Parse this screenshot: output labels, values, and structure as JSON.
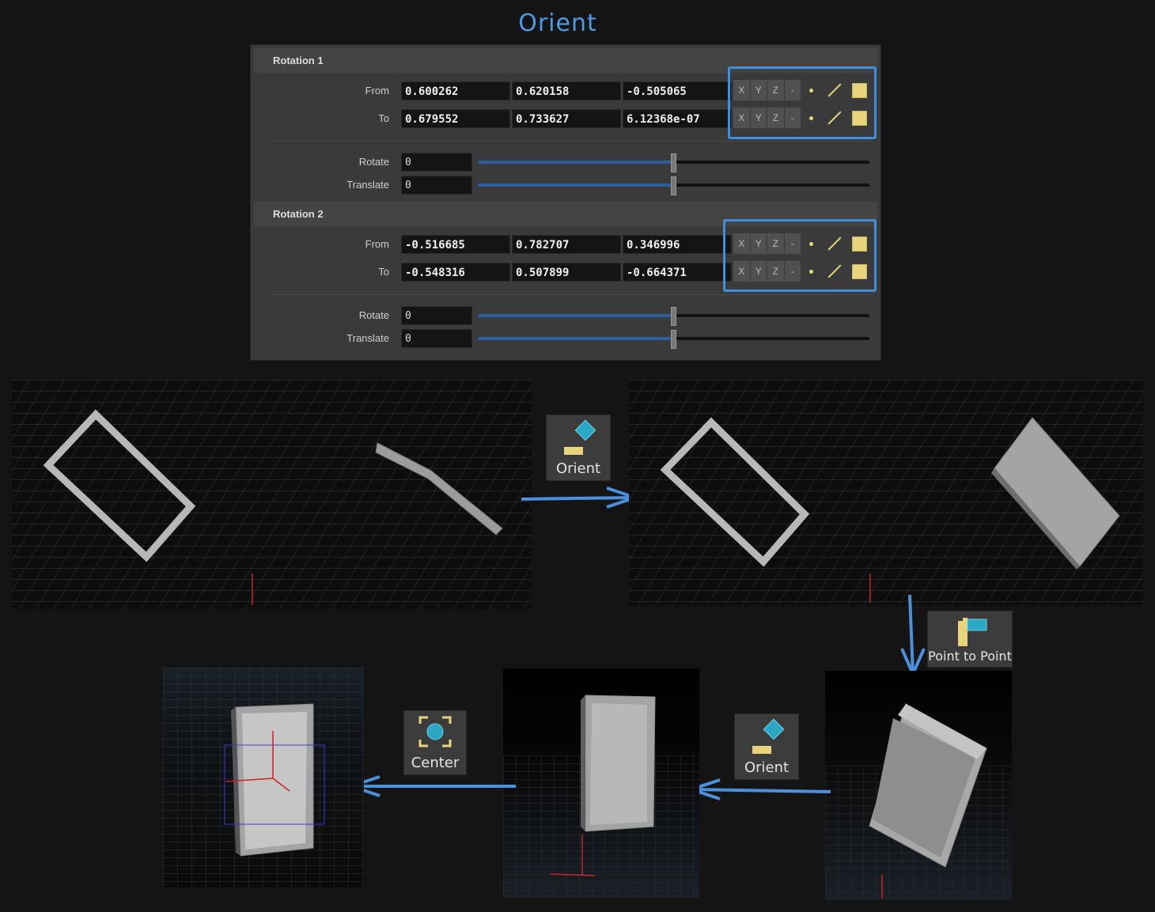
{
  "title": "Orient",
  "colors": {
    "accent": "#3f8fde",
    "icon_yellow": "#e8d47c",
    "icon_cyan": "#2aa8c6"
  },
  "panel": {
    "sections": [
      {
        "header": "Rotation 1",
        "from_label": "From",
        "to_label": "To",
        "from": [
          "0.600262",
          "0.620158",
          "-0.505065"
        ],
        "to": [
          "0.679552",
          "0.733627",
          "6.12368e-07"
        ],
        "rotate_label": "Rotate",
        "rotate_value": "0",
        "translate_label": "Translate",
        "translate_value": "0"
      },
      {
        "header": "Rotation 2",
        "from_label": "From",
        "to_label": "To",
        "from": [
          "-0.516685",
          "0.782707",
          "0.346996"
        ],
        "to": [
          "-0.548316",
          "0.507899",
          "-0.664371"
        ],
        "rotate_label": "Rotate",
        "rotate_value": "0",
        "translate_label": "Translate",
        "translate_value": "0"
      }
    ],
    "axis_buttons": [
      "X",
      "Y",
      "Z",
      "-"
    ]
  },
  "nodes": {
    "orient_1": {
      "label": "Orient",
      "icon": "orient-icon"
    },
    "point_to_point": {
      "label": "Point to Point",
      "icon": "point-to-point-icon"
    },
    "orient_2": {
      "label": "Orient",
      "icon": "orient-icon"
    },
    "center": {
      "label": "Center",
      "icon": "center-icon"
    }
  }
}
